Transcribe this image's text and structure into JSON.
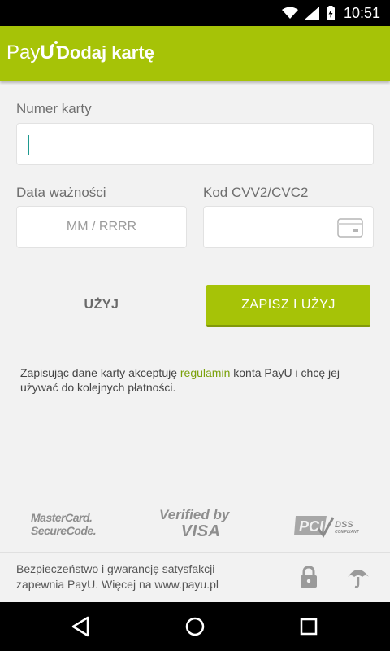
{
  "status_bar": {
    "time": "10:51",
    "icons": [
      "wifi-icon",
      "signal-icon",
      "battery-icon"
    ]
  },
  "app_bar": {
    "logo_pay": "Pay",
    "logo_u": "U",
    "title": "Dodaj kartę",
    "background_color": "#a6c307"
  },
  "form": {
    "card_number_label": "Numer karty",
    "card_number_value": "",
    "expiry_label": "Data ważności",
    "expiry_placeholder": "MM / RRRR",
    "cvv_label": "Kod CVV2/CVC2",
    "cvv_value": "",
    "cvv_icon": "card-cvv-icon"
  },
  "actions": {
    "use_label": "UŻYJ",
    "save_use_label": "ZAPISZ I UŻYJ",
    "accent_color": "#a6c307"
  },
  "terms": {
    "prefix": "Zapisując dane karty akceptuję ",
    "link": "regulamin",
    "suffix": " konta PayU i chcę jej używać do kolejnych płatności."
  },
  "security_logos": {
    "mastercard_line1": "MasterCard.",
    "mastercard_line2": "SecureCode.",
    "visa_line1": "Verified by",
    "visa_line2": "VISA",
    "pci_text": "PCI",
    "pci_dss": "DSS",
    "pci_compliant": "COMPLIANT"
  },
  "footer": {
    "text": "Bezpieczeństwo i gwarancję satysfakcji zapewnia PayU. Więcej na www.payu.pl",
    "icons": [
      "lock-icon",
      "umbrella-icon"
    ]
  },
  "nav_bar": {
    "icons": [
      "back-icon",
      "home-icon",
      "recents-icon"
    ]
  }
}
